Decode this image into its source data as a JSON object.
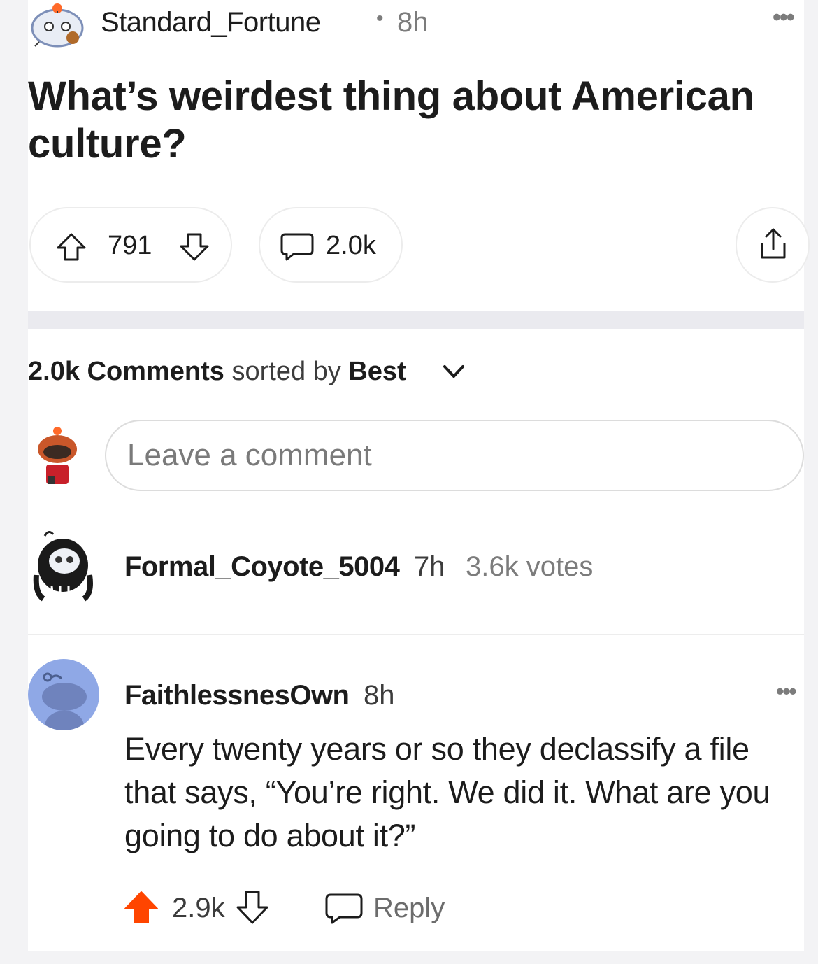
{
  "post": {
    "author": "Standard_Fortune",
    "separator": "•",
    "age": "8h",
    "more": "•••",
    "title": "What’s weirdest thing about American culture?",
    "upvotes": "791",
    "comments_count": "2.0k"
  },
  "sort": {
    "count": "2.0k",
    "label": "Comments",
    "sorted_by": "sorted by",
    "mode": "Best"
  },
  "comment_input": {
    "placeholder": "Leave a comment"
  },
  "comments": [
    {
      "author": "Formal_Coyote_5004",
      "age": "7h",
      "votes": "3.6k votes"
    },
    {
      "author": "FaithlessnesOwn",
      "age": "8h",
      "more": "•••",
      "body": "Every twenty years or so they declassify a file that says, “You’re right. We did it. What are you going to do about it?”",
      "score": "2.9k",
      "reply_label": "Reply"
    }
  ],
  "colors": {
    "upvote_active": "#ff4500",
    "avatar_blue": "#8fa8e6",
    "band": "#eaeaef"
  }
}
